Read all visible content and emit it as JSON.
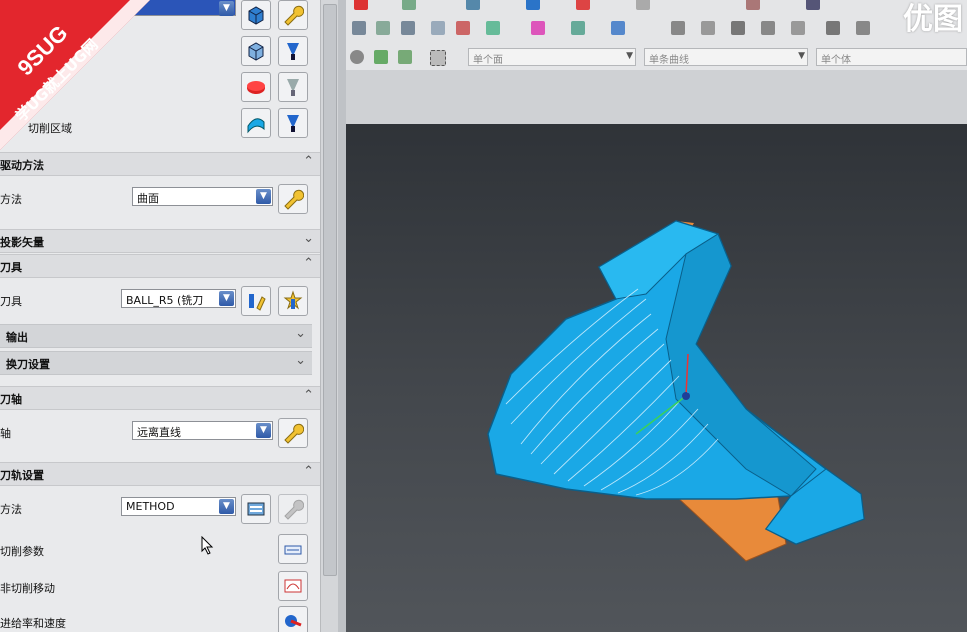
{
  "watermark": {
    "brand": "9SUG",
    "slogan": "学UG就上UG网"
  },
  "dialog": {
    "cut_area_label": "切削区域",
    "sections": {
      "drive_method": {
        "title": "驱动方法",
        "method_label": "方法",
        "method_value": "曲面"
      },
      "projection_vector": {
        "title": "投影矢量"
      },
      "tool": {
        "title": "刀具",
        "tool_label": "刀具",
        "tool_value": "BALL_R5 (铣刀",
        "output": "输出",
        "tool_change": "换刀设置"
      },
      "tool_axis": {
        "title": "刀轴",
        "axis_label": "轴",
        "axis_value": "远离直线"
      },
      "path_settings": {
        "title": "刀轨设置",
        "method_label": "方法",
        "method_value": "METHOD",
        "cut_params": "切削参数",
        "non_cut_moves": "非切削移动",
        "feeds_speeds": "进给率和速度"
      }
    }
  },
  "selection_bar": {
    "face_filter": "单个面",
    "curve_filter": "单条曲线",
    "body_filter": "单个体"
  },
  "header_partial_text": "优图",
  "colors": {
    "part": "#1aa8e6",
    "stock": "#e88a3a",
    "viewport_top": "#2f3338",
    "header_bg": "#dcdde0",
    "watermark": "#e3262d"
  },
  "icons": [
    "selection-icon",
    "specify-icon",
    "cube-icon",
    "wrench-icon",
    "drive-surface-icon",
    "tool-blue-icon",
    "tool-grey-icon",
    "tool-edit-icon",
    "tool-new-icon",
    "cut-params-icon",
    "non-cut-moves-icon",
    "feeds-speeds-icon",
    "cursor-icon"
  ]
}
